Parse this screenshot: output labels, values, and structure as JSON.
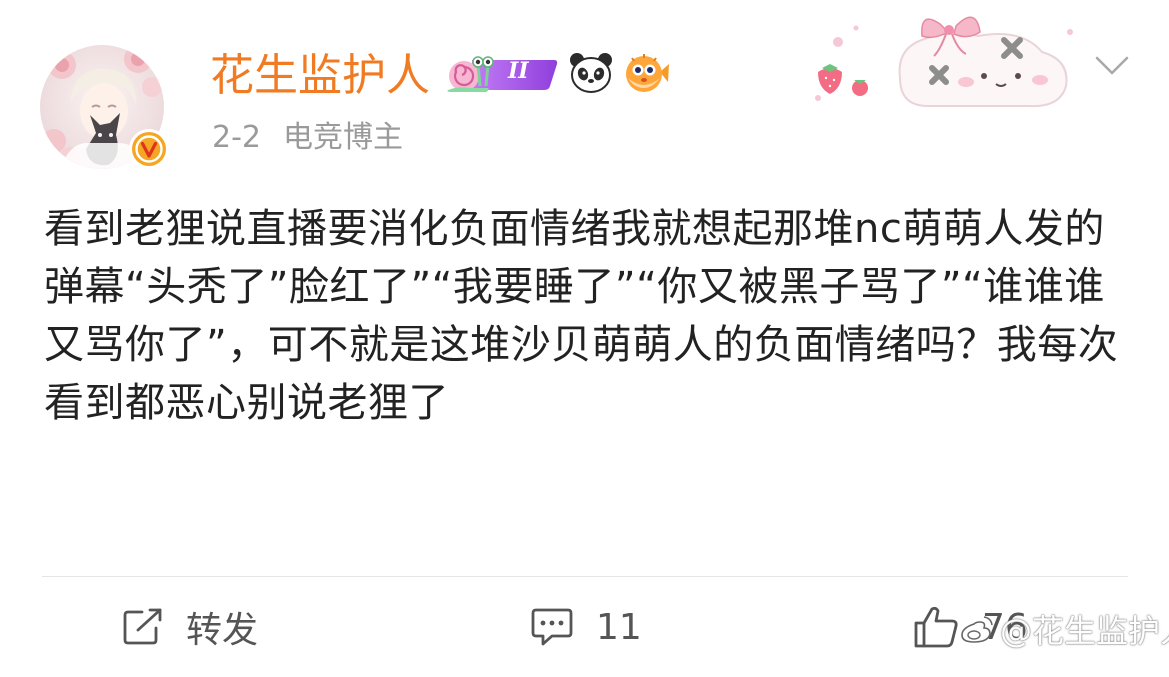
{
  "header": {
    "username": "花生监护人",
    "level": "II",
    "date": "2-2",
    "user_tag": "电竞博主"
  },
  "badges": {
    "snail_icon": "snail-badge-icon",
    "panda_icon": "panda-badge-icon",
    "pufferfish_icon": "pufferfish-badge-icon"
  },
  "post": {
    "text": "看到老狸说直播要消化负面情绪我就想起那堆nc萌萌人发的弹幕“头秃了”脸红了”“我要睡了”“你又被黑子骂了”“谁谁谁又骂你了”，可不就是这堆沙贝萌萌人的负面情绪吗？我每次看到都恶心别说老狸了"
  },
  "actions": {
    "repost_label": "转发",
    "comment_count": "11",
    "like_count": "76"
  },
  "watermark": {
    "text": "@花生监护人"
  },
  "colors": {
    "username": "#f07b23",
    "meta": "#9a9a9a",
    "verified_badge": "#f5a623",
    "level_badge": "#a454e8"
  }
}
